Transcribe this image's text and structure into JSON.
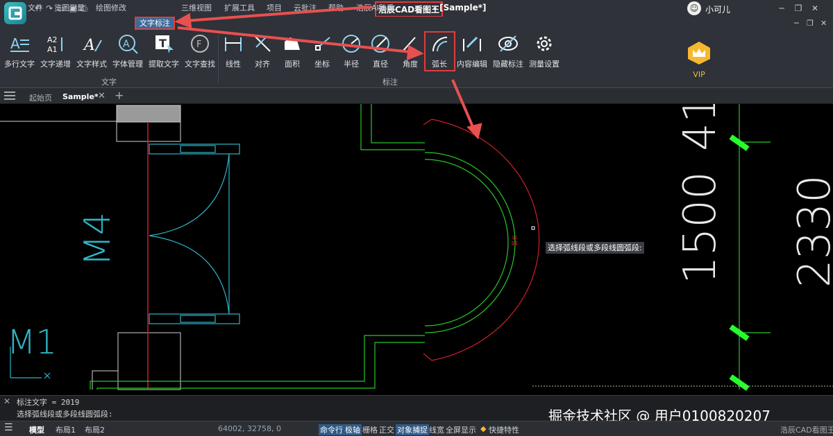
{
  "app": {
    "name": "浩辰CAD看图王",
    "document": " - [Sample*]",
    "user": "小可儿"
  },
  "menu": [
    "文件",
    "览图测量",
    "绘图修改",
    "文字标注",
    "三维视图",
    "扩展工具",
    "项目",
    "云批注",
    "帮助",
    "浩辰AI助手"
  ],
  "active_menu": "文字标注",
  "ribbon": {
    "text_group": {
      "label": "文字",
      "buttons": [
        "多行文字",
        "文字递增",
        "文字样式",
        "字体管理",
        "提取文字",
        "文字查找"
      ]
    },
    "dim_group": {
      "label": "标注",
      "buttons": [
        "线性",
        "对齐",
        "面积",
        "坐标",
        "半径",
        "直径",
        "角度",
        "弧长",
        "内容编辑",
        "隐藏标注",
        "测量设置"
      ]
    },
    "vip": "VIP"
  },
  "tabs": [
    "起始页",
    "Sample*"
  ],
  "icons": [
    "app-logo-icon",
    "undo-icon",
    "redo-icon",
    "open-icon",
    "save-icon",
    "print-icon",
    "close-icon",
    "add-tab-icon",
    "hamburger-icon",
    "gear-icon",
    "eye-icon",
    "crown-icon"
  ],
  "drawing_text": {
    "m4": "M4",
    "m1": "M1",
    "n1500": "1500",
    "n2330": "2330",
    "n41": "41",
    "arc_label": "弧长",
    "tooltip": "选择弧线段或多段线圆弧段:"
  },
  "command": {
    "line1": "标注文字 = 2019",
    "line2": "选择弧线段或多段线圆弧段:"
  },
  "watermark": "掘金技术社区 @ 用户0100820207",
  "status": {
    "model": "模型",
    "layout1": "布局1",
    "layout2": "布局2",
    "coords": "64002, 32758, 0",
    "items": [
      "命令行",
      "极轴",
      "栅格",
      "正交",
      "对象捕捉",
      "线宽",
      "全屏显示",
      "快捷特性"
    ],
    "app": "浩辰CAD看图王"
  },
  "colors": {
    "accent": "#3d6b9a",
    "highlight": "#e23c3c",
    "cad_cyan": "#2fb4c7",
    "cad_green": "#27c82a",
    "cad_red": "#d21e2a",
    "vip_gold": "#f5b92f"
  }
}
